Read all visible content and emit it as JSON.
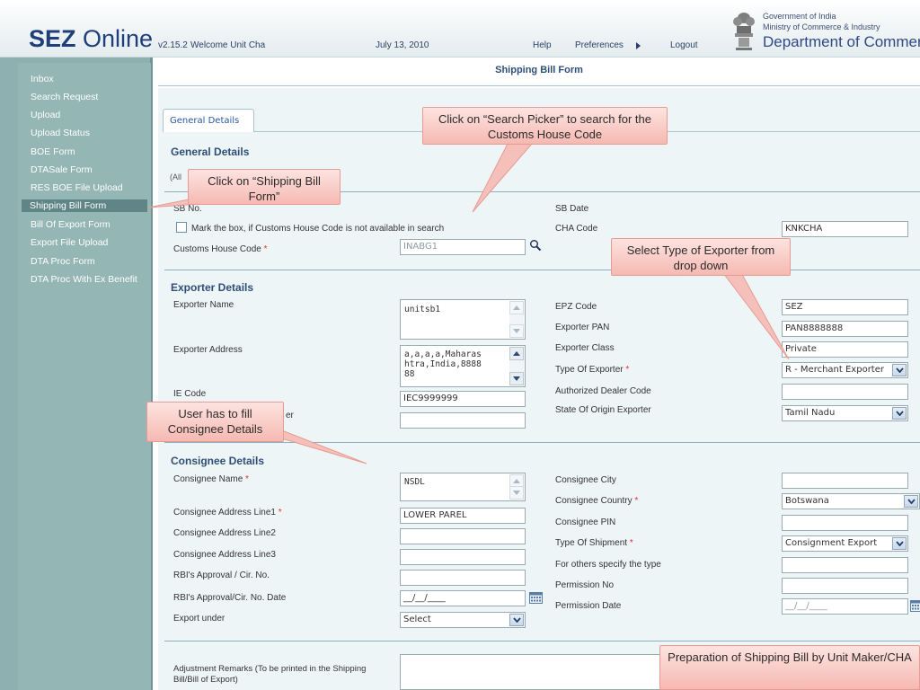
{
  "header": {
    "app_name": "SEZ",
    "app_name_suffix": "Online",
    "version": "v2.15.2",
    "welcome": "Welcome Unit Cha",
    "date": "July 13, 2010",
    "help": "Help",
    "preferences": "Preferences",
    "logout": "Logout",
    "gov_line1": "Government of India",
    "gov_line2": "Ministry of Commerce & Industry",
    "gov_line3": "Department of Commerce"
  },
  "sidebar": {
    "items": [
      {
        "label": "Inbox"
      },
      {
        "label": "Search Request"
      },
      {
        "label": "Upload"
      },
      {
        "label": "Upload Status"
      },
      {
        "label": "BOE Form"
      },
      {
        "label": "DTASale Form"
      },
      {
        "label": "RES BOE File Upload"
      },
      {
        "label": "Shipping Bill Form",
        "active": true
      },
      {
        "label": "Bill Of Export Form"
      },
      {
        "label": "Export File Upload"
      },
      {
        "label": "DTA Proc Form"
      },
      {
        "label": "DTA Proc With Ex Benefit"
      }
    ]
  },
  "form": {
    "title": "Shipping Bill Form",
    "tab": "General Details",
    "general": {
      "heading": "General Details",
      "note": "(All",
      "sb_no_label": "SB No.",
      "sb_date_label": "SB Date",
      "checkbox_label": "Mark the box, if Customs House Code is not available in search",
      "cha_code_label": "CHA Code",
      "cha_code_value": "KNKCHA",
      "customs_house_label": "Customs House Code",
      "customs_house_value": "INABG1",
      "required_mark": "*"
    },
    "exporter": {
      "heading": "Exporter Details",
      "name_label": "Exporter Name",
      "name_value": "unitsb1",
      "address_label": "Exporter Address",
      "address_value": "a,a,a,a,Maharas\nhtra,India,8888\n88",
      "ie_code_label": "IE Code",
      "ie_code_value": "IEC9999999",
      "label_partial": "er",
      "epz_label": "EPZ Code",
      "epz_value": "SEZ",
      "pan_label": "Exporter PAN",
      "pan_value": "PAN8888888",
      "class_label": "Exporter Class",
      "class_value": "Private",
      "type_label": "Type Of Exporter",
      "type_value": "R - Merchant Exporter",
      "dealer_label": "Authorized Dealer Code",
      "state_label": "State Of Origin Exporter",
      "state_value": "Tamil Nadu"
    },
    "consignee": {
      "heading": "Consignee Details",
      "name_label": "Consignee Name",
      "name_value": "NSDL",
      "addr1_label": "Consignee Address Line1",
      "addr1_value": "LOWER PAREL",
      "addr2_label": "Consignee Address Line2",
      "addr3_label": "Consignee Address Line3",
      "rbi_label": "RBI's Approval / Cir. No.",
      "rbi_date_label": "RBI's Approval/Cir. No. Date",
      "rbi_date_value": "__/__/____",
      "export_under_label": "Export under",
      "export_under_value": "Select",
      "city_label": "Consignee City",
      "country_label": "Consignee Country",
      "country_value": "Botswana",
      "pin_label": "Consignee PIN",
      "shipment_label": "Type Of Shipment",
      "shipment_value": "Consignment Export",
      "others_label": "For others specify the type",
      "permission_no_label": "Permission No",
      "permission_date_label": "Permission Date",
      "permission_date_value": "__/__/____",
      "remarks_label": "Adjustment Remarks (To be printed in the Shipping Bill/Bill of Export)"
    }
  },
  "callouts": {
    "search_picker": "Click on “Search Picker” to search for the Customs House Code",
    "shipping_bill": "Click on “Shipping Bill Form”",
    "exporter_type": "Select Type of Exporter from drop down",
    "consignee": "User has to fill Consignee Details",
    "preparation": "Preparation of Shipping Bill by Unit Maker/CHA"
  },
  "colors": {
    "sidebar_bg": "#94b6b5",
    "sidebar_active": "#5f8587",
    "heading_blue": "#2d4f77",
    "callout_pink": "#f6b9b2"
  }
}
